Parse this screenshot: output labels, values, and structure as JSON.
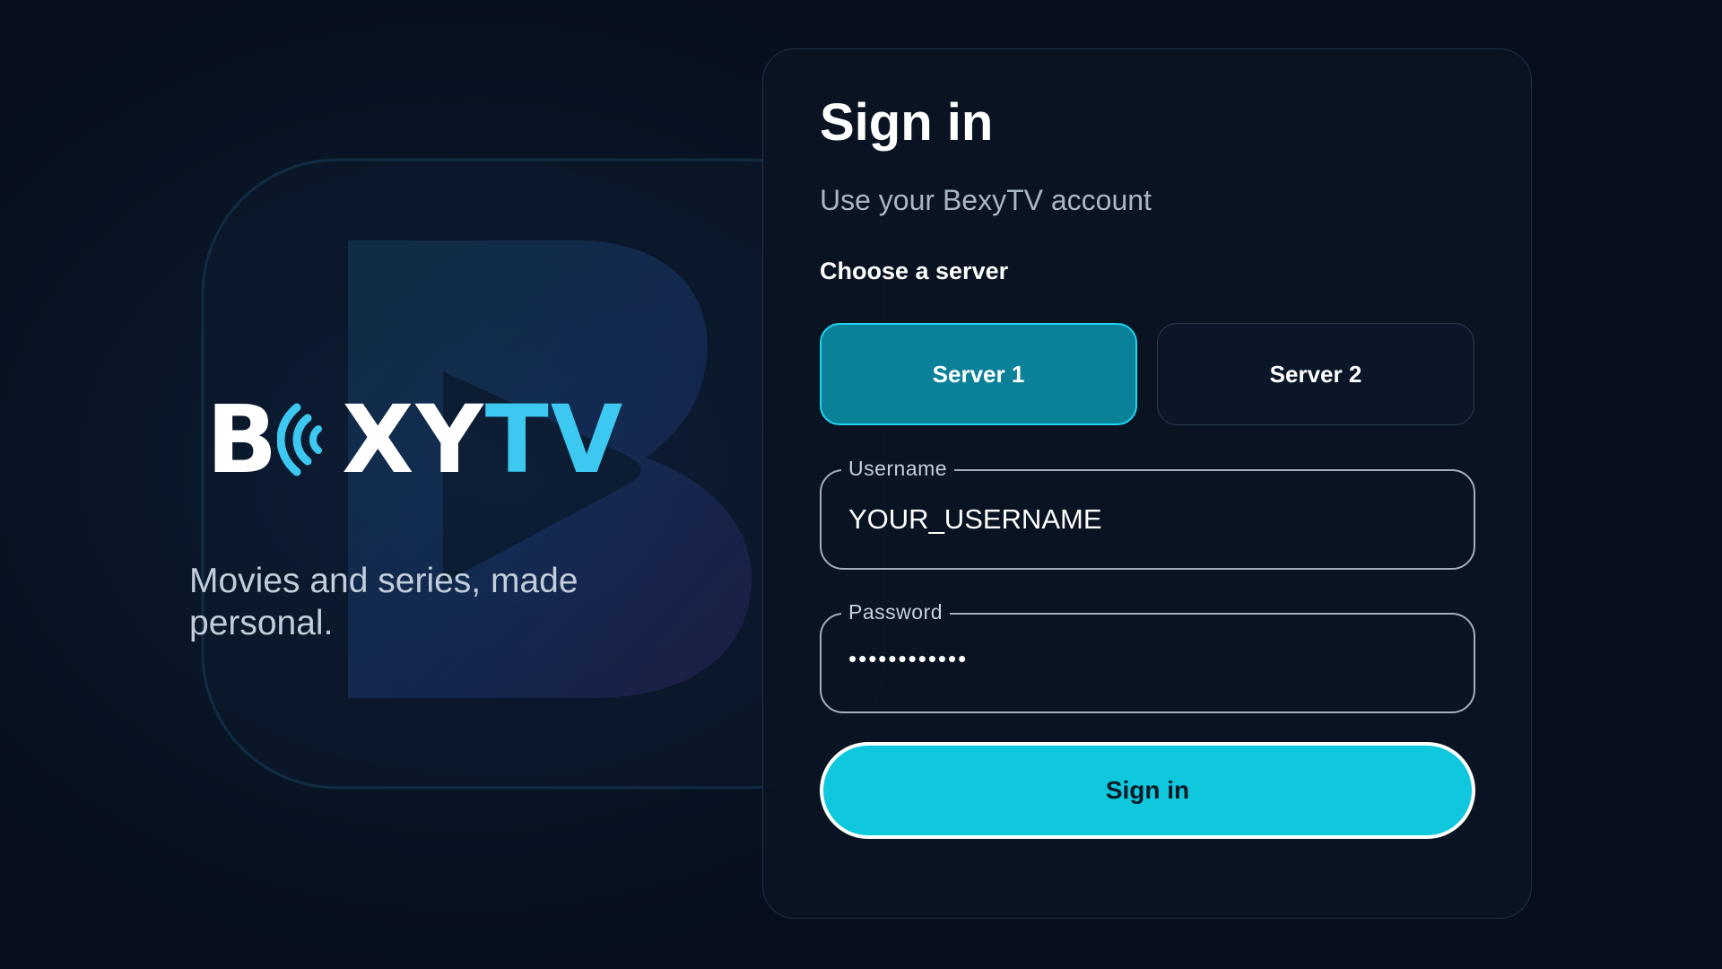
{
  "brand": {
    "letter_b": "B",
    "letters_xy": "XY",
    "letters_tv": "TV",
    "waves_icon": "wifi-waves-icon",
    "tagline": "Movies and series, made personal."
  },
  "signin": {
    "title": "Sign in",
    "subtitle": "Use your BexyTV account",
    "server_prompt": "Choose a server",
    "servers": [
      {
        "label": "Server 1",
        "selected": true
      },
      {
        "label": "Server 2",
        "selected": false
      }
    ],
    "username": {
      "label": "Username",
      "value": "YOUR_USERNAME"
    },
    "password": {
      "label": "Password",
      "value": "••••••••••••"
    },
    "submit_label": "Sign in"
  },
  "colors": {
    "accent": "#10c8dd",
    "selected_server": "#0a8199",
    "brand_cyan": "#3cc8f0",
    "background": "#070f1c"
  }
}
